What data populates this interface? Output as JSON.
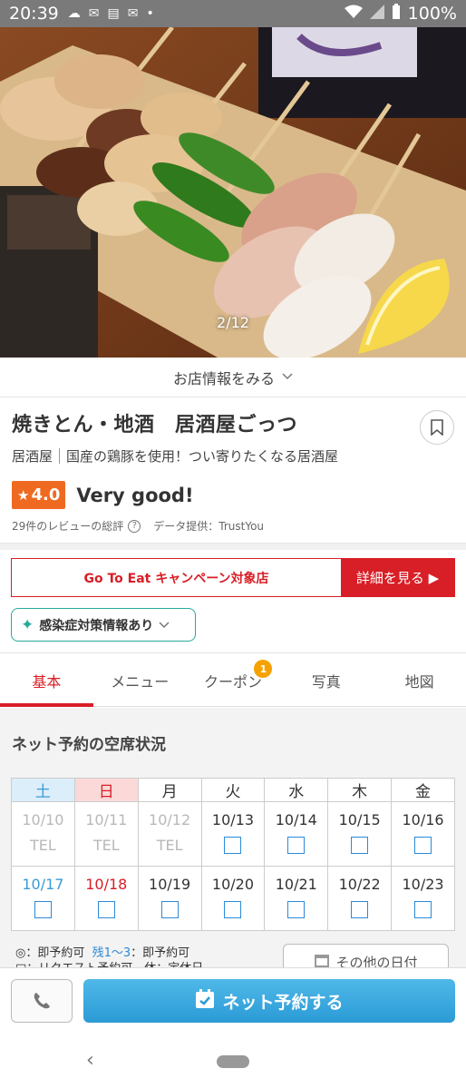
{
  "status_bar": {
    "time": "20:39",
    "battery": "100%",
    "icons": [
      "cloud-icon",
      "gmail-icon",
      "news-icon",
      "mail-icon",
      "dot-icon",
      "wifi-icon",
      "signal-icon",
      "battery-icon"
    ]
  },
  "hero": {
    "counter": "2/12"
  },
  "shop_info_toggle": "お店情報をみる",
  "shop": {
    "name": "焼きとん・地酒　居酒屋ごっつ",
    "genre": "居酒屋",
    "tagline": "国産の鶏豚を使用！つい寄りたくなる居酒屋",
    "rating": "4.0",
    "rating_label": "Very good!",
    "review_summary": "29件のレビューの総評",
    "data_provider": "データ提供：TrustYou"
  },
  "campaign": {
    "label": "Go To Eat キャンペーン対象店",
    "button": "詳細を見る ▶"
  },
  "covid_info": "感染症対策情報あり",
  "tabs": [
    {
      "label": "基本",
      "active": true
    },
    {
      "label": "メニュー"
    },
    {
      "label": "クーポン",
      "badge": "1"
    },
    {
      "label": "写真"
    },
    {
      "label": "地図"
    }
  ],
  "availability": {
    "title": "ネット予約の空席状況",
    "weekdays": [
      "土",
      "日",
      "月",
      "火",
      "水",
      "木",
      "金"
    ],
    "week1": [
      {
        "date": "10/10",
        "status": "TEL"
      },
      {
        "date": "10/11",
        "status": "TEL"
      },
      {
        "date": "10/12",
        "status": "TEL"
      },
      {
        "date": "10/13",
        "status": "□"
      },
      {
        "date": "10/14",
        "status": "□"
      },
      {
        "date": "10/15",
        "status": "□"
      },
      {
        "date": "10/16",
        "status": "□"
      }
    ],
    "week2": [
      {
        "date": "10/17",
        "status": "□"
      },
      {
        "date": "10/18",
        "status": "□"
      },
      {
        "date": "10/19",
        "status": "□"
      },
      {
        "date": "10/20",
        "status": "□"
      },
      {
        "date": "10/21",
        "status": "□"
      },
      {
        "date": "10/22",
        "status": "□"
      },
      {
        "date": "10/23",
        "status": "□"
      }
    ],
    "legend_line1_a": "◎：即予約可",
    "legend_line1_b": "残1〜3",
    "legend_line1_c": "：即予約可",
    "legend_line2": "□：リクエスト予約可　休：定休日",
    "other_dates": "その他の日付"
  },
  "bottom": {
    "reserve": "ネット予約する"
  },
  "colors": {
    "accent_red": "#d81e26",
    "rating_orange": "#ef6a21",
    "reserve_blue": "#2b9bd6",
    "covid_teal": "#2aa89b",
    "coupon_badge": "#f5a200"
  }
}
